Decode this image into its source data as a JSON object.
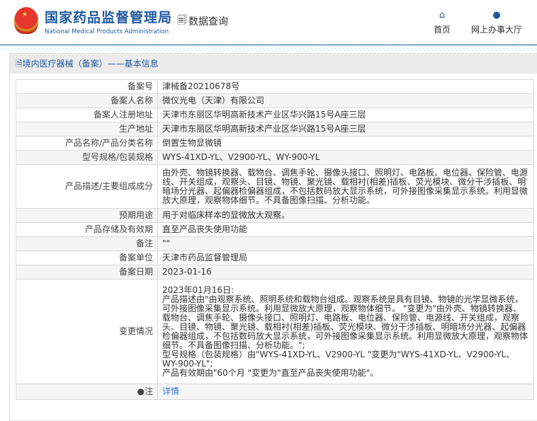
{
  "header": {
    "org_cn": "国家药品监督管理局",
    "org_en": "National Medical Products Administration",
    "query_label": "数据查询",
    "nav": [
      {
        "label": "首页",
        "icon": "home-icon"
      },
      {
        "label": "网上办事大厅",
        "icon": "user-icon"
      }
    ]
  },
  "panel": {
    "title": "境内医疗器械（备案）——基本信息"
  },
  "rows": [
    {
      "label": "备案号",
      "value": "津械备20210678号"
    },
    {
      "label": "备案人名称",
      "value": "微仪光电（天津）有限公司"
    },
    {
      "label": "备案人注册地址",
      "value": "天津市东丽区华明高新技术产业区华兴路15号A座三层"
    },
    {
      "label": "生产地址",
      "value": "天津市东丽区华明高新技术产业区华兴路15号A座三层"
    },
    {
      "label": "产品名称/产品分类名称",
      "value": "倒置生物显微镜"
    },
    {
      "label": "型号规格/包装规格",
      "value": "WYS-41XD-YL、V2900-YL、WY-900-YL"
    },
    {
      "label": "产品描述/主要组成成分",
      "value": "由外壳、物镜转换器、载物台、调焦手轮、摄像头接口、照明灯、电路板、电位器、保险管、电源线、开关组成，观察头、目镜、物镜、聚光镜、载相衬(相差)插板、荧光模块、微分干涉插板、明暗场分光器、起偏器检偏器组成，不包括数码放大显示系统，可外接图像采集显示系统。利用显微放大原理，观察物体细节。不具备图像扫描、分析功能。"
    },
    {
      "label": "预期用途",
      "value": "用于对临床样本的显微放大观察。"
    },
    {
      "label": "产品存储及有效期",
      "value": "直至产品丧失使用功能"
    },
    {
      "label": "备注",
      "value": "\"\""
    },
    {
      "label": "备案单位",
      "value": "天津市药品监督管理局"
    },
    {
      "label": "备案日期",
      "value": "2023-01-16"
    }
  ],
  "change": {
    "label": "变更情况",
    "lines": [
      "2023年01月16日:",
      "产品描述由\"由观察系统、照明系统和载物台组成。观察系统是具有目镜、物镜的光学显微系统，可外接图像采集显示系统。利用显微放大原理，观察物体细节。 \"变更为\"由外壳、物镜转换器、载物台、调焦手轮、摄像头接口、照明灯、电路板、电位器、保险管、电源线、开关组成，观察头、目镜、物镜、聚光镜、载相衬(相差)插板、荧光模块、微分干涉插板、明暗场分光器、起偏器检偏器组成，不包括数码放大显示系统，可外接图像采集显示系统。利用显微放大原理，观察物体细节。不具备图像扫描、分析功能。\";",
      "型号规格（包装规格）由\"WYS-41XD-YL、V2900-YL \"变更为\"WYS-41XD-YL、V2900-YL、WY-900-YL\";",
      "产品有效期由\"60个月 \"变更为\"直至产品丧失使用功能\"。"
    ]
  },
  "note": {
    "label": "注",
    "link": "详情"
  }
}
